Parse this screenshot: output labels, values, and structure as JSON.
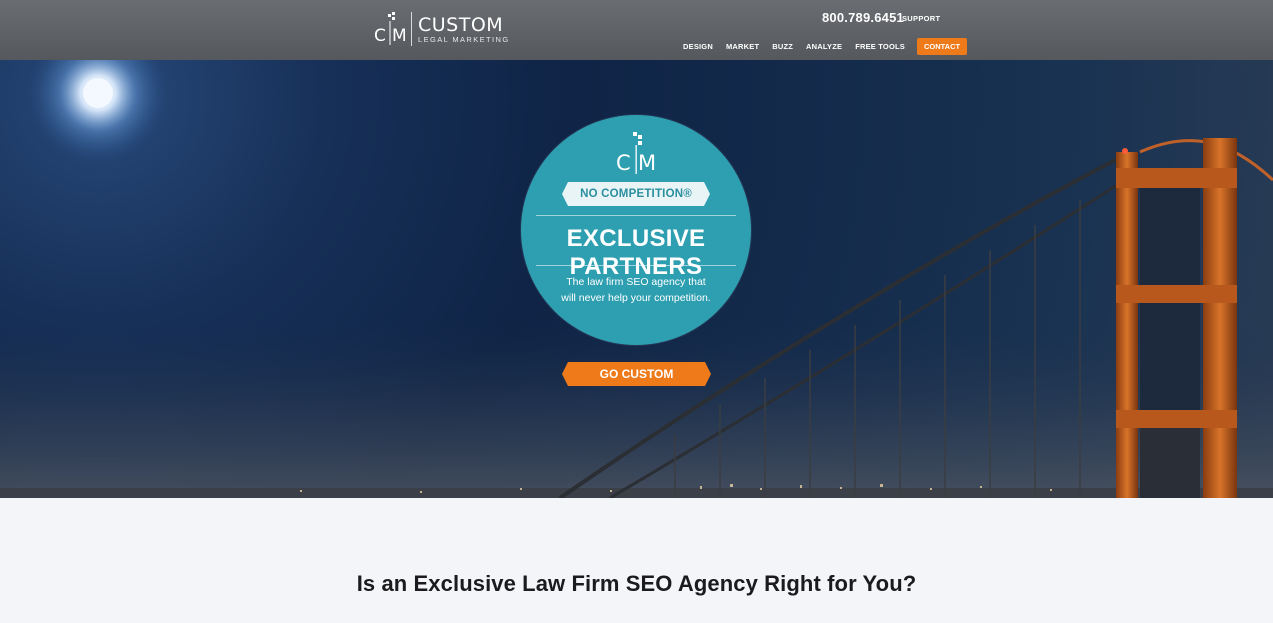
{
  "header": {
    "logo": {
      "mark": "C|M",
      "name": "CUSTOM",
      "tagline": "LEGAL MARKETING"
    },
    "phone": "800.789.6451",
    "support_label": "SUPPORT",
    "nav": [
      {
        "label": "DESIGN"
      },
      {
        "label": "MARKET"
      },
      {
        "label": "BUZZ"
      },
      {
        "label": "ANALYZE"
      },
      {
        "label": "FREE TOOLS"
      }
    ],
    "contact_label": "CONTACT"
  },
  "hero": {
    "badge": {
      "logo_mark": "C|M",
      "ribbon": "NO COMPETITION®",
      "title": "EXCLUSIVE PARTNERS",
      "description": "The law firm SEO agency that will never help your competition."
    },
    "cta_label": "GO CUSTOM"
  },
  "section": {
    "heading": "Is an Exclusive Law Firm SEO Agency Right for You?"
  },
  "colors": {
    "header_bg": "#5f6267",
    "accent_orange": "#ee7a1a",
    "badge_teal": "#2e9fb0",
    "ribbon_bg": "#e9f4f6",
    "section_bg": "#f4f5f8",
    "bridge_orange": "#c8641c"
  }
}
